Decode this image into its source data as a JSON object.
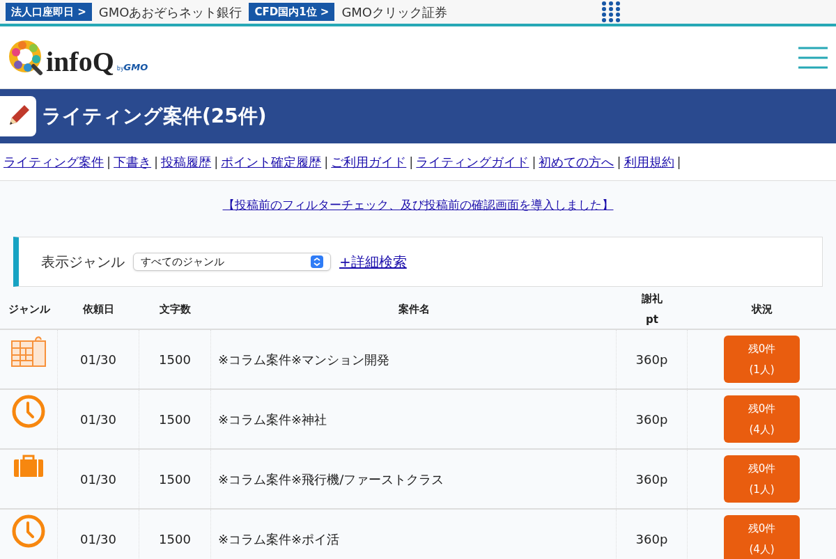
{
  "promo_bar": [
    {
      "badge": "法人口座即日 >",
      "text": "GMOあおぞらネット銀行"
    },
    {
      "badge": "CFD国内1位 >",
      "text": "GMOクリック証券"
    }
  ],
  "logo": {
    "name": "infoQ",
    "by": "by",
    "brand": "GMO"
  },
  "title_bar": {
    "title": "ライティング案件(25件)"
  },
  "nav": [
    {
      "label": "ライティング案件",
      "separator": "|"
    },
    {
      "label": "下書き",
      "separator": "|"
    },
    {
      "label": "投稿履歴",
      "separator": "|"
    },
    {
      "label": "ポイント確定履歴",
      "separator": "|"
    },
    {
      "label": "ご利用ガイド",
      "separator": "|"
    },
    {
      "label": "ライティングガイド",
      "separator": "|"
    },
    {
      "label": "初めての方へ",
      "separator": "|"
    },
    {
      "label": "利用規約",
      "separator": "|"
    }
  ],
  "notice": "【投稿前のフィルターチェック、及び投稿前の確認画面を導入しました】",
  "filter": {
    "label": "表示ジャンル",
    "select_value": "すべてのジャンル",
    "advanced_link": "+詳細検索"
  },
  "table": {
    "columns": [
      "ジャンル",
      "依頼日",
      "文字数",
      "案件名",
      [
        "謝礼",
        "pt"
      ],
      "状況"
    ],
    "rows": [
      {
        "kind": "building",
        "date": "01/30",
        "chars": "1500",
        "title": "※コラム案件※マンション開発",
        "reward": "360p",
        "status": [
          "残0件",
          "(1人)"
        ]
      },
      {
        "kind": "clock",
        "date": "01/30",
        "chars": "1500",
        "title": "※コラム案件※神社",
        "reward": "360p",
        "status": [
          "残0件",
          "(4人)"
        ]
      },
      {
        "kind": "suitcase",
        "date": "01/30",
        "chars": "1500",
        "title": "※コラム案件※飛行機/ファーストクラス",
        "reward": "360p",
        "status": [
          "残0件",
          "(1人)"
        ]
      },
      {
        "kind": "clock",
        "date": "01/30",
        "chars": "1500",
        "title": "※コラム案件※ポイ活",
        "reward": "360p",
        "status": [
          "残0件",
          "(4人)"
        ]
      }
    ]
  }
}
